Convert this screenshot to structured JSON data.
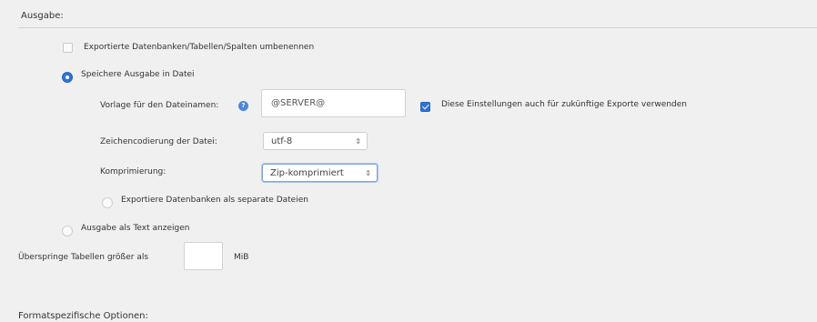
{
  "output": {
    "section_title": "Ausgabe:",
    "rename_option": {
      "label": "Exportierte Datenbanken/Tabellen/Spalten umbenennen",
      "checked": false
    },
    "save_to_file": {
      "label": "Speichere Ausgabe in Datei",
      "selected": true
    },
    "filename_template": {
      "label": "Vorlage für den Dateinamen:",
      "value": "@SERVER@",
      "help_icon": "help-icon"
    },
    "remember_settings": {
      "label": "Diese Einstellungen auch für zukünftige Exporte verwenden",
      "checked": true
    },
    "charset": {
      "label": "Zeichencodierung der Datei:",
      "value": "utf-8"
    },
    "compression": {
      "label": "Komprimierung:",
      "value": "Zip-komprimiert"
    },
    "separate_files": {
      "label": "Exportiere Datenbanken als separate Dateien",
      "selected": false
    },
    "show_as_text": {
      "label": "Ausgabe als Text anzeigen",
      "selected": false
    },
    "skip_tables": {
      "label": "Überspringe Tabellen größer als",
      "value": "",
      "unit": "MiB"
    }
  },
  "format_options": {
    "section_title": "Formatspezifische Optionen:"
  },
  "colors": {
    "accent": "#2f73d3",
    "background": "#f0f0f0"
  }
}
